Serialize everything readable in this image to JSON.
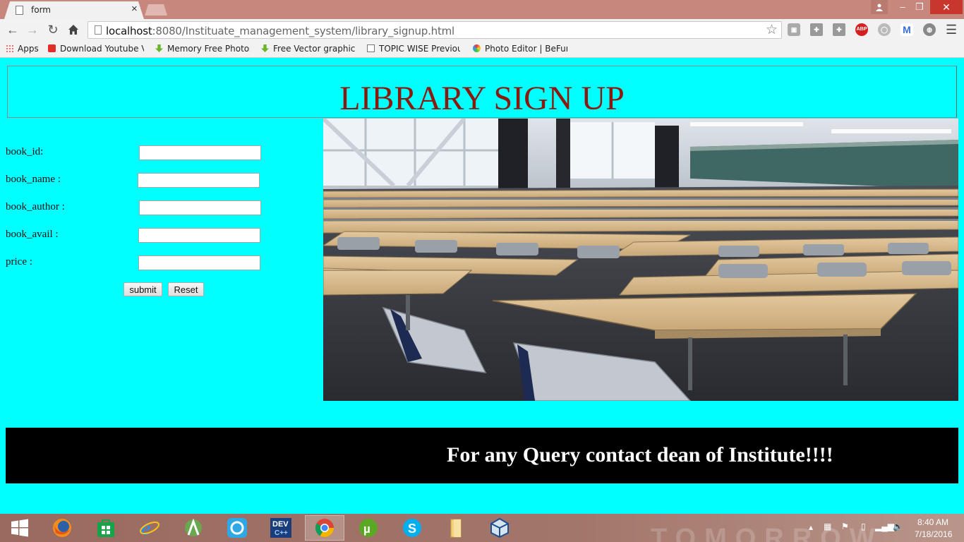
{
  "browser": {
    "tab_title": "form",
    "url_host": "localhost",
    "url_rest": ":8080/Instituate_management_system/library_signup.html",
    "bookmarks": [
      {
        "label": "Apps",
        "icon": "apps-icon"
      },
      {
        "label": "Download Youtube Vi",
        "icon": "youtube-icon"
      },
      {
        "label": "Memory Free Photos f",
        "icon": "download-arrow-icon"
      },
      {
        "label": "Free Vector graphic ar",
        "icon": "download-arrow-icon"
      },
      {
        "label": "TOPIC WISE Previous",
        "icon": "page-icon"
      },
      {
        "label": "Photo Editor | BeFunk",
        "icon": "befunky-icon"
      }
    ],
    "extensions": [
      "office-icon",
      "puzzle-icon",
      "puzzle-icon",
      "adblock-plus-icon",
      "circle-icon",
      "gmail-icon",
      "globe-icon"
    ],
    "adblock_label": "ABP"
  },
  "page": {
    "title": "LIBRARY SIGN UP",
    "form": {
      "fields": [
        {
          "label": "book_id:",
          "value": ""
        },
        {
          "label": "book_name :",
          "value": ""
        },
        {
          "label": "book_author :",
          "value": ""
        },
        {
          "label": "book_avail :",
          "value": ""
        },
        {
          "label": "price :",
          "value": ""
        }
      ],
      "submit_label": "submit",
      "reset_label": "Reset"
    },
    "image_subject": "empty classroom with rows of desks and chairs",
    "footer_text": "For any Query contact dean of Institute!!!!"
  },
  "taskbar": {
    "apps": [
      "windows-start-icon",
      "firefox-icon",
      "windows-store-icon",
      "internet-explorer-icon",
      "android-studio-icon",
      "shareit-icon",
      "devcpp-icon",
      "chrome-icon",
      "utorrent-icon",
      "skype-icon",
      "file-explorer-icon",
      "virtualbox-icon"
    ],
    "devcpp_label": "DEV C++",
    "time": "8:40 AM",
    "date": "7/18/2016",
    "wallpaper_text": "TOMORROW"
  },
  "colors": {
    "page_background": "#00ffff",
    "title_color": "#8b1a0e",
    "footer_background": "#000000",
    "footer_text": "#ffffff"
  }
}
